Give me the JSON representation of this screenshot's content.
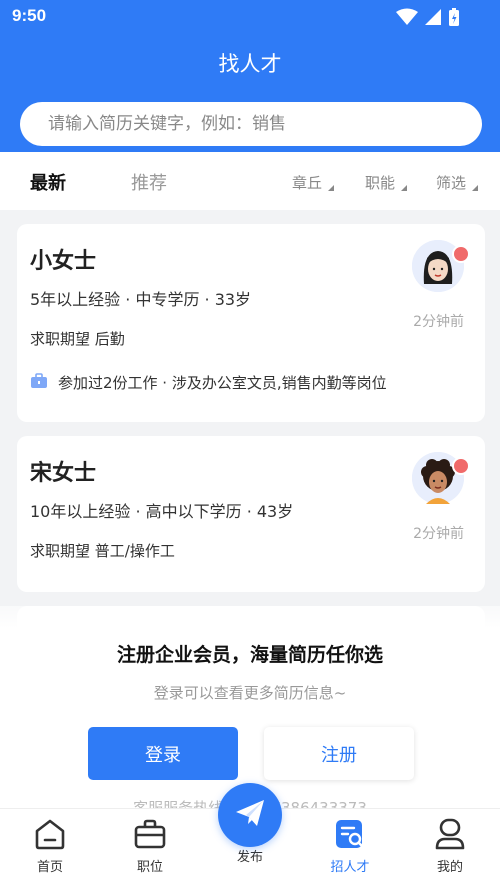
{
  "status_bar": {
    "time": "9:50"
  },
  "header": {
    "title": "找人才"
  },
  "search": {
    "placeholder": "请输入简历关键字，例如：销售"
  },
  "tabs": [
    {
      "label": "最新"
    },
    {
      "label": "推荐"
    }
  ],
  "filters": [
    {
      "label": "章丘"
    },
    {
      "label": "职能"
    },
    {
      "label": "筛选"
    }
  ],
  "resumes": [
    {
      "name": "小女士",
      "info": "5年以上经验 · 中专学历 · 33岁",
      "expect": "求职期望 后勤",
      "experience": "参加过2份工作 · 涉及办公室文员,销售内勤等岗位",
      "time": "2分钟前"
    },
    {
      "name": "宋女士",
      "info": "10年以上经验 · 高中以下学历 · 43岁",
      "expect": "求职期望 普工/操作工",
      "time": "2分钟前"
    }
  ],
  "promo": {
    "title": "注册企业会员，海量简历任你选",
    "subtitle": "登录可以查看更多简历信息~",
    "login_label": "登录",
    "register_label": "注册",
    "hotline": "客服服务热线 0531-7386433373"
  },
  "bottom_nav": [
    {
      "label": "首页",
      "icon": "home-icon"
    },
    {
      "label": "职位",
      "icon": "briefcase-icon"
    },
    {
      "label": "发布",
      "icon": "paper-plane-icon"
    },
    {
      "label": "招人才",
      "icon": "resume-search-icon"
    },
    {
      "label": "我的",
      "icon": "user-icon"
    }
  ],
  "colors": {
    "primary": "#2f7bf6",
    "badge": "#f06a6a"
  }
}
